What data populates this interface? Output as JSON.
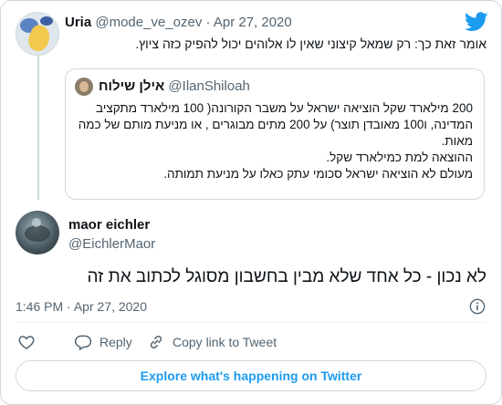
{
  "colors": {
    "brand": "#1d9bf0",
    "text": "#0f1419",
    "secondary": "#536471",
    "border": "#cfd9de"
  },
  "parent_tweet": {
    "author_name": "Uria",
    "handle": "@mode_ve_ozev",
    "separator": "·",
    "date": "Apr 27, 2020",
    "text": "אומר זאת כך: רק שמאל קיצוני שאין לו אלוהים יכול להפיק כזה ציוץ.",
    "avatar_icon": "avatar-image"
  },
  "quoted_tweet": {
    "author_name": "אילן שילוח",
    "handle": "@IlanShiloah",
    "lines": [
      "200 מילארד שקל הוציאה ישראל על משבר הקורונה( 100 מילארד מתקציב המדינה, ו100 מאובדן תוצר) על 200 מתים מבוגרים , או מניעת מותם של כמה מאות.",
      "ההוצאה למת כמילארד שקל.",
      "מעולם לא הוציאה ישראל סכומי עתק כאלו על מניעת תמותה."
    ]
  },
  "main_tweet": {
    "author_name": "maor eichler",
    "handle": "@EichlerMaor",
    "text": "לא נכון - כל אחד שלא מבין בחשבון מסוגל לכתוב את זה",
    "time": "1:46 PM",
    "separator": "·",
    "date": "Apr 27, 2020"
  },
  "actions": {
    "like_icon": "heart-icon",
    "reply_label": "Reply",
    "reply_icon": "reply-icon",
    "copy_label": "Copy link to Tweet",
    "copy_icon": "link-icon"
  },
  "footer": {
    "explore_label": "Explore what's happening on Twitter"
  },
  "logo_icon": "twitter-bird-icon",
  "info_icon": "info-icon"
}
